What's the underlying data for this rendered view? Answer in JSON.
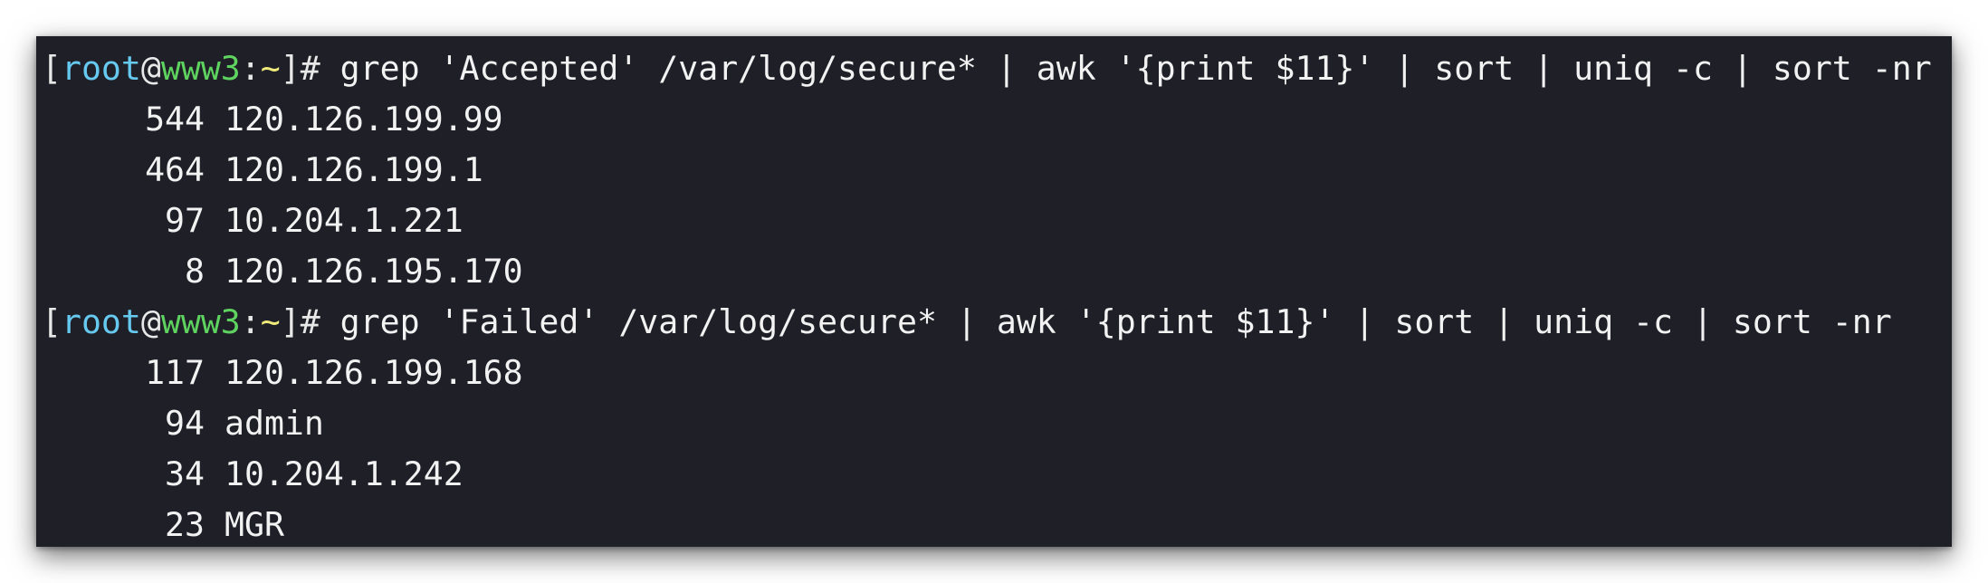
{
  "terminal": {
    "blocks": [
      {
        "prompt": {
          "open_bracket": "[",
          "user": "root",
          "at": "@",
          "host": "www3",
          "colon": ":",
          "path": "~",
          "close": "]#"
        },
        "command": " grep 'Accepted' /var/log/secure* | awk '{print $11}' | sort | uniq -c | sort -nr",
        "rows": [
          {
            "count": "544",
            "value": "120.126.199.99"
          },
          {
            "count": "464",
            "value": "120.126.199.1"
          },
          {
            "count": "97",
            "value": "10.204.1.221"
          },
          {
            "count": "8",
            "value": "120.126.195.170"
          }
        ]
      },
      {
        "prompt": {
          "open_bracket": "[",
          "user": "root",
          "at": "@",
          "host": "www3",
          "colon": ":",
          "path": "~",
          "close": "]#"
        },
        "command": " grep 'Failed' /var/log/secure* | awk '{print $11}' | sort | uniq -c | sort -nr",
        "rows": [
          {
            "count": "117",
            "value": "120.126.199.168"
          },
          {
            "count": "94",
            "value": "admin"
          },
          {
            "count": "34",
            "value": "10.204.1.242"
          },
          {
            "count": "23",
            "value": "MGR"
          }
        ]
      }
    ]
  },
  "colors": {
    "background": "#1f1f28",
    "user": "#66c9f0",
    "host": "#5fd35f",
    "path": "#f0ea7a",
    "text": "#f2f2f2"
  }
}
